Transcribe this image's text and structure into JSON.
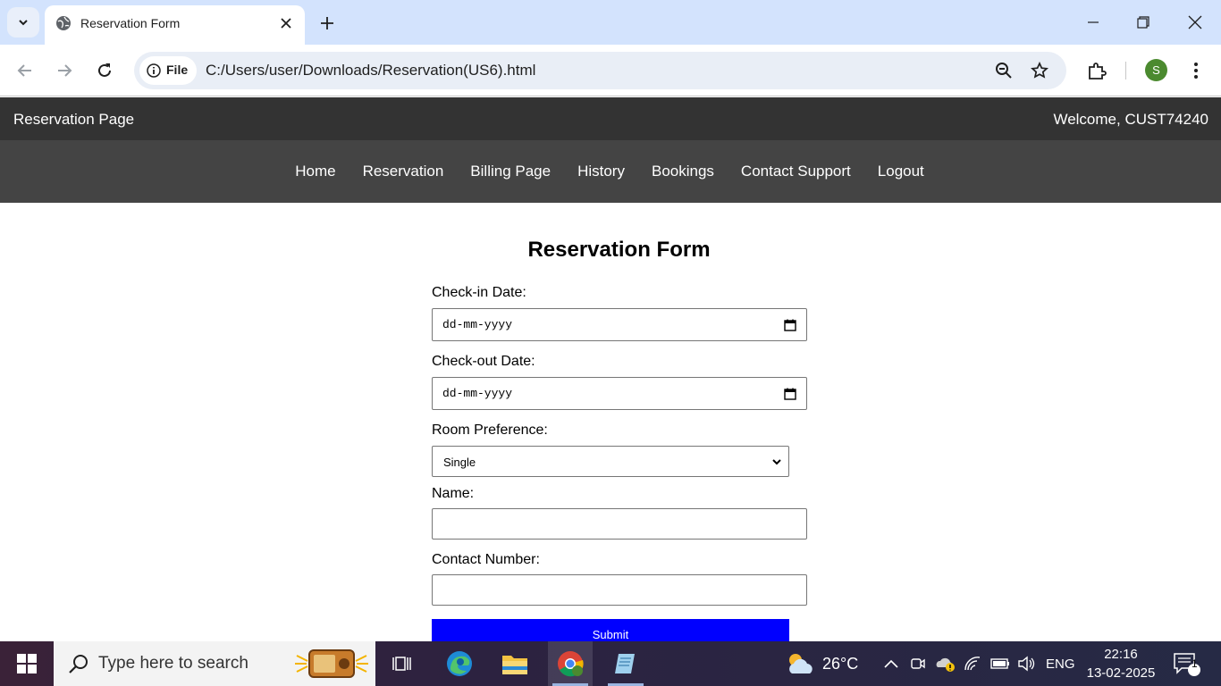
{
  "browser": {
    "tab_title": "Reservation Form",
    "chip_label": "File",
    "url": "C:/Users/user/Downloads/Reservation(US6).html",
    "profile_initial": "S"
  },
  "header": {
    "title": "Reservation Page",
    "welcome": "Welcome, CUST74240"
  },
  "nav": {
    "items": [
      "Home",
      "Reservation",
      "Billing Page",
      "History",
      "Bookings",
      "Contact Support",
      "Logout"
    ]
  },
  "form": {
    "title": "Reservation Form",
    "checkin_label": "Check-in Date:",
    "checkin_placeholder": "dd-mm-yyyy",
    "checkout_label": "Check-out Date:",
    "checkout_placeholder": "dd-mm-yyyy",
    "room_label": "Room Preference:",
    "room_value": "Single",
    "name_label": "Name:",
    "name_value": "",
    "contact_label": "Contact Number:",
    "contact_value": "",
    "submit_label": "Submit"
  },
  "taskbar": {
    "search_placeholder": "Type here to search",
    "weather": "26°C",
    "language": "ENG",
    "time": "22:16",
    "date": "13-02-2025",
    "notification_count": "1"
  }
}
